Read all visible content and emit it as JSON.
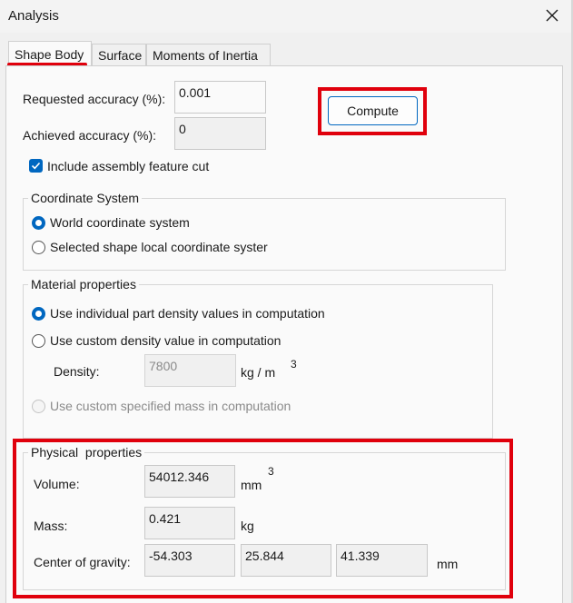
{
  "window": {
    "title": "Analysis",
    "close_icon": "close-icon"
  },
  "tabs": [
    "Shape Body",
    "Surface",
    "Moments of Inertia"
  ],
  "accuracy": {
    "requested_label": "Requested accuracy (%):",
    "requested_value": "0.001",
    "achieved_label": "Achieved accuracy (%):",
    "achieved_value": "0"
  },
  "compute_button": "Compute",
  "include_cut_label": "Include assembly feature cut",
  "coordinate_system": {
    "title": "Coordinate System",
    "world": "World coordinate system",
    "local": "Selected shape local coordinate syster"
  },
  "material": {
    "title": "Material properties",
    "individual": "Use individual part density values in computation",
    "custom_density": "Use custom density value in computation",
    "density_label": "Density:",
    "density_value": "7800",
    "density_unit": "kg / m",
    "density_unit_exp": "3",
    "custom_mass": "Use custom specified mass in computation"
  },
  "physical": {
    "title": "Physical  properties",
    "volume_label": "Volume:",
    "volume_value": "54012.346",
    "volume_unit": "mm",
    "volume_unit_exp": "3",
    "mass_label": "Mass:",
    "mass_value": "0.421",
    "mass_unit": "kg",
    "cog_label": "Center of gravity:",
    "cog_x": "-54.303",
    "cog_y": "25.844",
    "cog_z": "41.339",
    "cog_unit": "mm"
  },
  "colors": {
    "accent": "#0067c0",
    "highlight": "#e0000c"
  }
}
